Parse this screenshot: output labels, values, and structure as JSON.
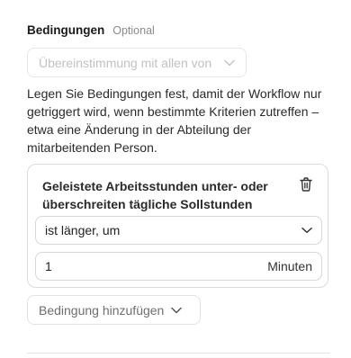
{
  "section": {
    "title": "Bedingungen",
    "optional": "Optional"
  },
  "match_select": {
    "value": "Übereinstimmung mit allen von",
    "icon": "chevron-down-icon"
  },
  "description": "Legen Sie Bedingungen fest, damit der Workflow nur getriggert wird, wenn bestimmte Kriterien zutreffen – etwa eine Änderung in der Abteilung der mitarbeitenden Person.",
  "condition": {
    "title": "Geleistete Arbeitsstunden unter- oder überschreiten tägliche Sollstunden",
    "delete_icon": "trash-icon",
    "operator": "ist länger, um",
    "value": "1",
    "unit": "Minuten"
  },
  "add_button": {
    "label": "Bedingung hinzufügen",
    "icon": "chevron-down-icon"
  },
  "colors": {
    "text": "#1f1f1f",
    "muted": "#8a8a8a",
    "border": "#d8d8d8"
  }
}
